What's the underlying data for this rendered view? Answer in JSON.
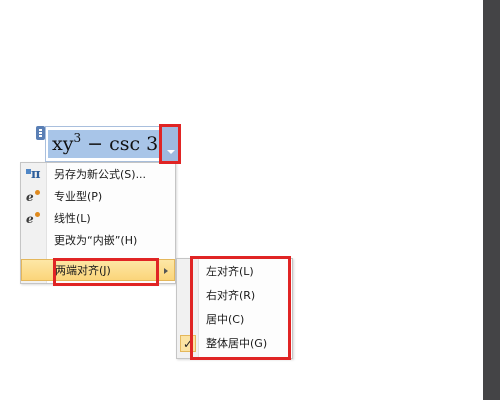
{
  "equation": {
    "base": "xy",
    "exponent": "3",
    "rest": " − csc 3"
  },
  "menu": {
    "items": [
      {
        "label": "另存为新公式(S)...",
        "icon": "save-as-equation-icon"
      },
      {
        "label": "专业型(P)",
        "icon": "professional-format-icon"
      },
      {
        "label": "线性(L)",
        "icon": "linear-format-icon"
      },
      {
        "label": "更改为“内嵌”(H)",
        "icon": ""
      },
      {
        "label": "两端对齐(J)",
        "icon": "",
        "highlighted": true,
        "has_submenu": true
      }
    ]
  },
  "submenu": {
    "items": [
      {
        "label": "左对齐(L)"
      },
      {
        "label": "右对齐(R)"
      },
      {
        "label": "居中(C)"
      },
      {
        "label": "整体居中(G)",
        "checked": true,
        "check_glyph": "✓"
      }
    ]
  },
  "colors": {
    "annotation": "#e02424",
    "highlight": "#fbd57a",
    "equation_selection": "#a8c5e8"
  }
}
